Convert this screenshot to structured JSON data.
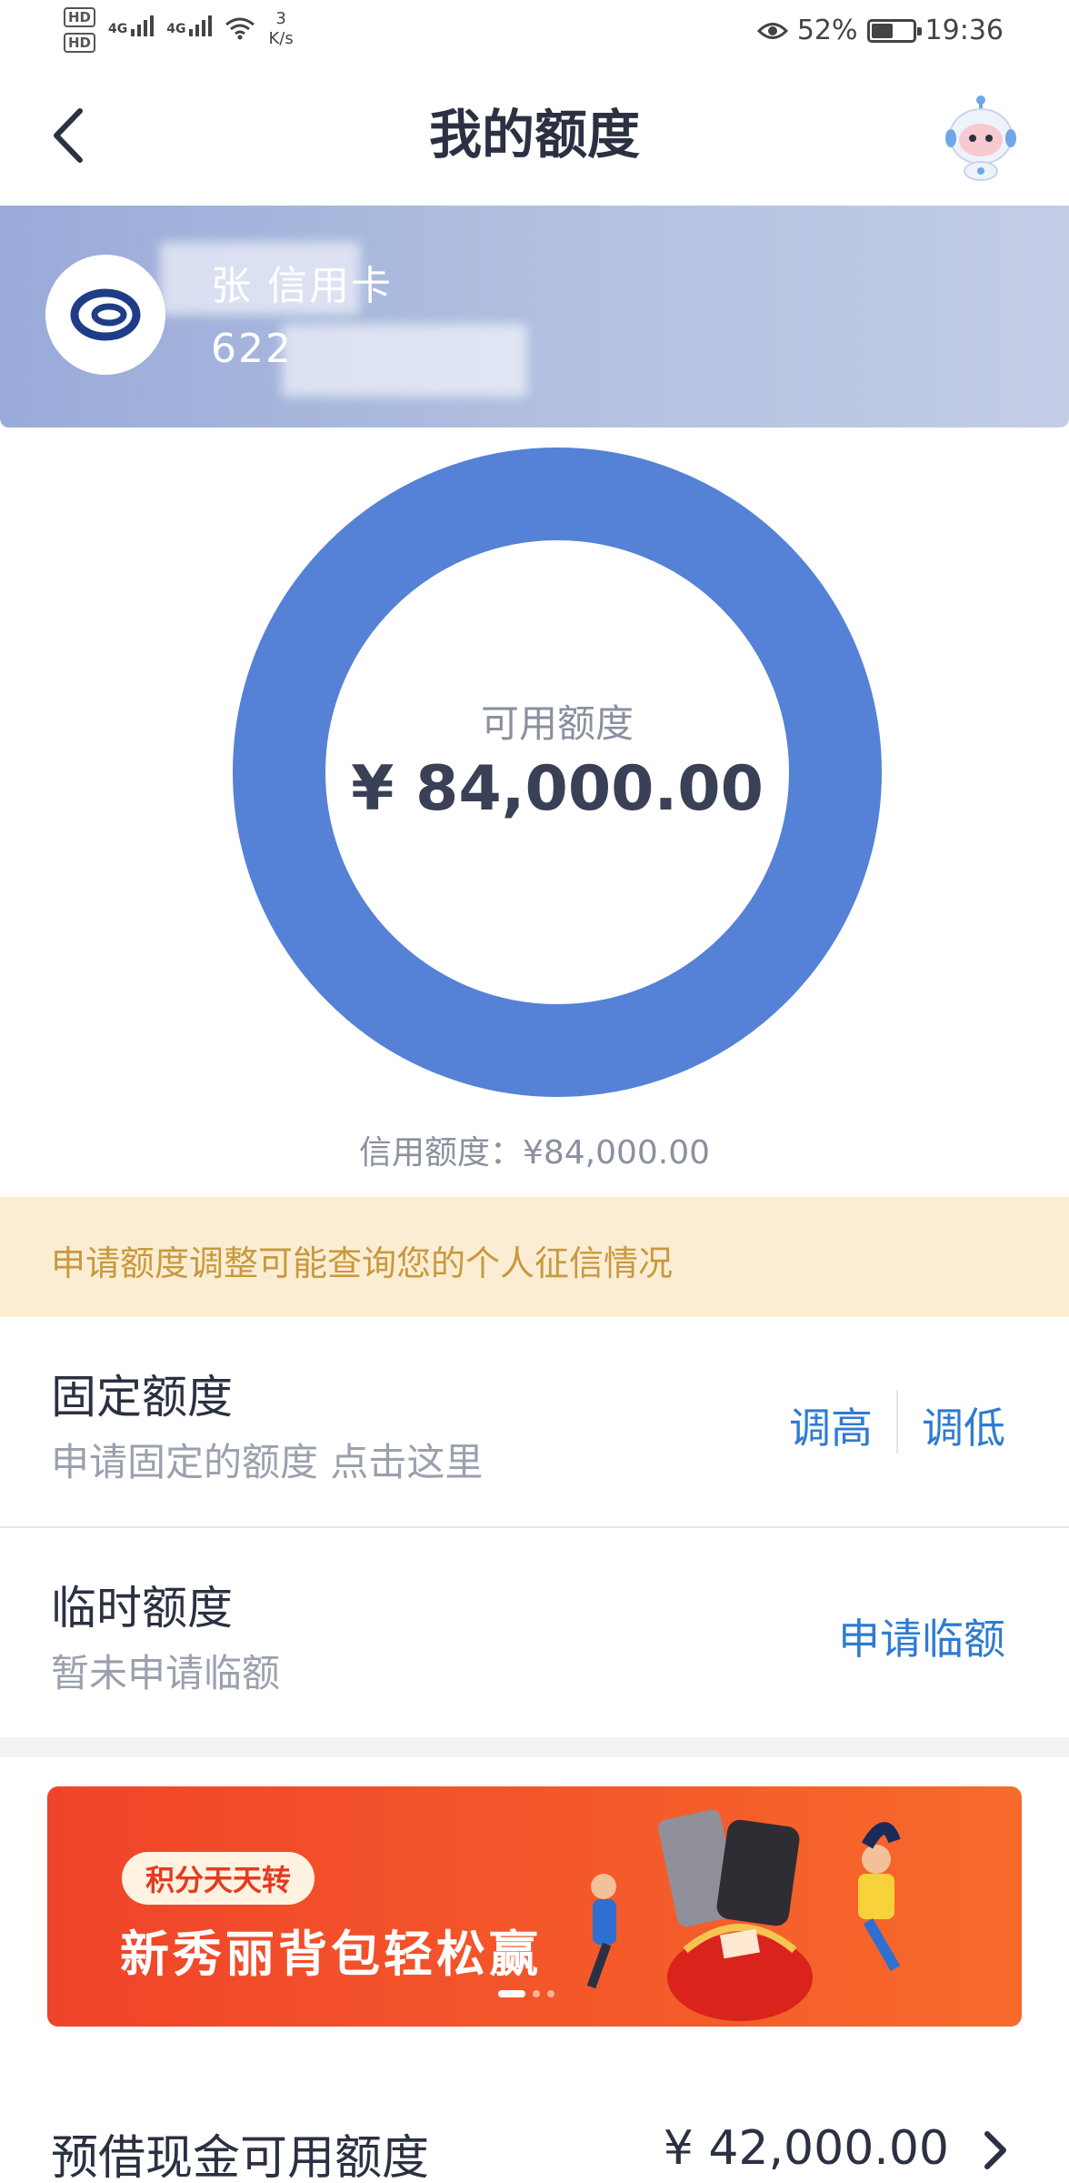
{
  "status_bar": {
    "sim1": "HD",
    "sim2": "HD",
    "net1": "4G",
    "net2": "4G",
    "speed_value": "3",
    "speed_unit": "K/s",
    "battery_percent": "52%",
    "battery_level": 0.52,
    "time": "19:36"
  },
  "header": {
    "title": "我的额度",
    "back_icon": "chevron-left-icon",
    "assistant_icon": "robot-assistant-icon"
  },
  "card": {
    "name": "张  信用卡",
    "number": "622 "
  },
  "limit": {
    "available_label": "可用额度",
    "available_amount": "¥ 84,000.00",
    "credit_limit_text": "信用额度：¥84,000.00",
    "available_ratio": 1.0,
    "ring_color": "#5582d6"
  },
  "notice": {
    "text": "申请额度调整可能查询您的个人征信情况"
  },
  "fixed_limit": {
    "title": "固定额度",
    "subtitle": "申请固定的额度 点击这里",
    "raise_label": "调高",
    "lower_label": "调低"
  },
  "temp_limit": {
    "title": "临时额度",
    "subtitle": "暂未申请临额",
    "apply_label": "申请临额"
  },
  "promo": {
    "tag": "积分天天转",
    "title": "新秀丽背包轻松赢",
    "slides": 3,
    "active_slide": 1
  },
  "cash_advance": {
    "title": "预借现金可用额度",
    "amount": "¥ 42,000.00"
  },
  "colors": {
    "accent_blue": "#2f7bd1",
    "notice_bg": "#fbedd3",
    "notice_text": "#c9993e",
    "promo_bg": "#f0442a"
  }
}
